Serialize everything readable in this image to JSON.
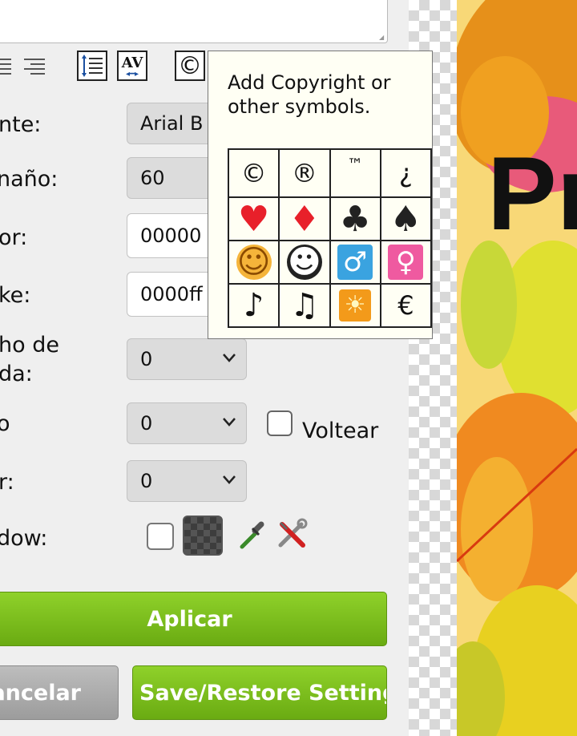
{
  "toolbar": {
    "icons": [
      "align-justify-icon",
      "align-right-icon",
      "line-height-icon",
      "letter-spacing-icon",
      "copyright-icon"
    ],
    "letter_spacing_label": "AV",
    "copyright_symbol": "©"
  },
  "form": {
    "font_label": "nte:",
    "font_value": "Arial B",
    "size_label": "naño:",
    "size_value": "60",
    "color_label": "or:",
    "color_value": "00000",
    "stroke_label": "ke:",
    "stroke_value": "0000ff",
    "stroke_width_label_line1": "ho de",
    "stroke_width_label_line2": "da:",
    "stroke_width_value": "0",
    "rotate_label": "o",
    "rotate_value": "0",
    "flip_label": "Voltear",
    "curve_label": "r:",
    "curve_value": "0",
    "shadow_label": "dow:"
  },
  "buttons": {
    "apply": "Aplicar",
    "cancel": "ancelar",
    "save_restore": "Save/Restore Setting"
  },
  "canvas": {
    "text": "Pr"
  },
  "popup": {
    "text": "Add Copyright or other symbols.",
    "symbols": [
      [
        "©",
        "®",
        "™",
        "¿"
      ],
      [
        "♥",
        "♦",
        "♣",
        "♠"
      ],
      [
        "☺",
        "☻",
        "♂",
        "♀"
      ],
      [
        "♪",
        "♫",
        "☀",
        "€"
      ]
    ]
  },
  "colors": {
    "button_green": "#7cbd1d",
    "heart_red": "#e8202a",
    "male_blue": "#3aa3e0",
    "female_pink": "#ef5aa0"
  }
}
